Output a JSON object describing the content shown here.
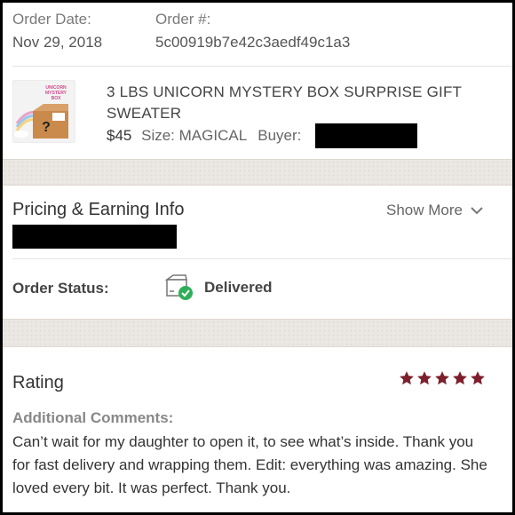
{
  "order": {
    "date_label": "Order Date:",
    "date_value": "Nov 29, 2018",
    "number_label": "Order #:",
    "number_value": "5c00919b7e42c3aedf49c1a3"
  },
  "item": {
    "title": "3 LBS UNICORN MYSTERY BOX SURPRISE GIFT SWEATER",
    "price": "$45",
    "size_label": "Size:",
    "size_value": "MAGICAL",
    "buyer_label": "Buyer:",
    "thumbnail_text": [
      "UNICORN",
      "MYSTERY",
      "BOX"
    ]
  },
  "pricing": {
    "title": "Pricing & Earning Info",
    "show_more": "Show More"
  },
  "status": {
    "label": "Order Status:",
    "value": "Delivered",
    "icon": "package-delivered-icon"
  },
  "rating": {
    "title": "Rating",
    "stars": 5,
    "star_color": "#7d1f2b",
    "comments_label": "Additional Comments:",
    "comments_text": "Can’t wait for my daughter to open it, to see what’s inside. Thank you for fast delivery and wrapping them. Edit: everything was amazing. She loved every bit. It was perfect. Thank you."
  },
  "colors": {
    "accent_dark_red": "#7d1f2b",
    "delivered_green": "#2fae5a"
  }
}
